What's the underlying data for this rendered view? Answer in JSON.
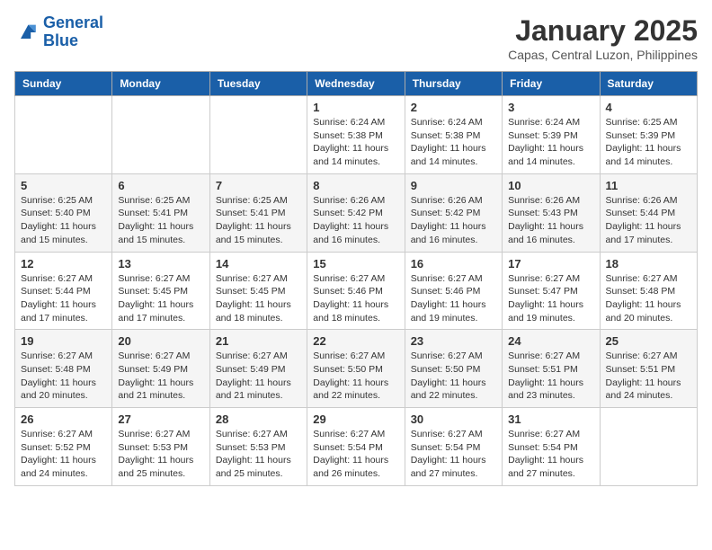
{
  "logo": {
    "line1": "General",
    "line2": "Blue"
  },
  "title": "January 2025",
  "subtitle": "Capas, Central Luzon, Philippines",
  "weekdays": [
    "Sunday",
    "Monday",
    "Tuesday",
    "Wednesday",
    "Thursday",
    "Friday",
    "Saturday"
  ],
  "weeks": [
    [
      {
        "day": "",
        "info": ""
      },
      {
        "day": "",
        "info": ""
      },
      {
        "day": "",
        "info": ""
      },
      {
        "day": "1",
        "info": "Sunrise: 6:24 AM\nSunset: 5:38 PM\nDaylight: 11 hours and 14 minutes."
      },
      {
        "day": "2",
        "info": "Sunrise: 6:24 AM\nSunset: 5:38 PM\nDaylight: 11 hours and 14 minutes."
      },
      {
        "day": "3",
        "info": "Sunrise: 6:24 AM\nSunset: 5:39 PM\nDaylight: 11 hours and 14 minutes."
      },
      {
        "day": "4",
        "info": "Sunrise: 6:25 AM\nSunset: 5:39 PM\nDaylight: 11 hours and 14 minutes."
      }
    ],
    [
      {
        "day": "5",
        "info": "Sunrise: 6:25 AM\nSunset: 5:40 PM\nDaylight: 11 hours and 15 minutes."
      },
      {
        "day": "6",
        "info": "Sunrise: 6:25 AM\nSunset: 5:41 PM\nDaylight: 11 hours and 15 minutes."
      },
      {
        "day": "7",
        "info": "Sunrise: 6:25 AM\nSunset: 5:41 PM\nDaylight: 11 hours and 15 minutes."
      },
      {
        "day": "8",
        "info": "Sunrise: 6:26 AM\nSunset: 5:42 PM\nDaylight: 11 hours and 16 minutes."
      },
      {
        "day": "9",
        "info": "Sunrise: 6:26 AM\nSunset: 5:42 PM\nDaylight: 11 hours and 16 minutes."
      },
      {
        "day": "10",
        "info": "Sunrise: 6:26 AM\nSunset: 5:43 PM\nDaylight: 11 hours and 16 minutes."
      },
      {
        "day": "11",
        "info": "Sunrise: 6:26 AM\nSunset: 5:44 PM\nDaylight: 11 hours and 17 minutes."
      }
    ],
    [
      {
        "day": "12",
        "info": "Sunrise: 6:27 AM\nSunset: 5:44 PM\nDaylight: 11 hours and 17 minutes."
      },
      {
        "day": "13",
        "info": "Sunrise: 6:27 AM\nSunset: 5:45 PM\nDaylight: 11 hours and 17 minutes."
      },
      {
        "day": "14",
        "info": "Sunrise: 6:27 AM\nSunset: 5:45 PM\nDaylight: 11 hours and 18 minutes."
      },
      {
        "day": "15",
        "info": "Sunrise: 6:27 AM\nSunset: 5:46 PM\nDaylight: 11 hours and 18 minutes."
      },
      {
        "day": "16",
        "info": "Sunrise: 6:27 AM\nSunset: 5:46 PM\nDaylight: 11 hours and 19 minutes."
      },
      {
        "day": "17",
        "info": "Sunrise: 6:27 AM\nSunset: 5:47 PM\nDaylight: 11 hours and 19 minutes."
      },
      {
        "day": "18",
        "info": "Sunrise: 6:27 AM\nSunset: 5:48 PM\nDaylight: 11 hours and 20 minutes."
      }
    ],
    [
      {
        "day": "19",
        "info": "Sunrise: 6:27 AM\nSunset: 5:48 PM\nDaylight: 11 hours and 20 minutes."
      },
      {
        "day": "20",
        "info": "Sunrise: 6:27 AM\nSunset: 5:49 PM\nDaylight: 11 hours and 21 minutes."
      },
      {
        "day": "21",
        "info": "Sunrise: 6:27 AM\nSunset: 5:49 PM\nDaylight: 11 hours and 21 minutes."
      },
      {
        "day": "22",
        "info": "Sunrise: 6:27 AM\nSunset: 5:50 PM\nDaylight: 11 hours and 22 minutes."
      },
      {
        "day": "23",
        "info": "Sunrise: 6:27 AM\nSunset: 5:50 PM\nDaylight: 11 hours and 22 minutes."
      },
      {
        "day": "24",
        "info": "Sunrise: 6:27 AM\nSunset: 5:51 PM\nDaylight: 11 hours and 23 minutes."
      },
      {
        "day": "25",
        "info": "Sunrise: 6:27 AM\nSunset: 5:51 PM\nDaylight: 11 hours and 24 minutes."
      }
    ],
    [
      {
        "day": "26",
        "info": "Sunrise: 6:27 AM\nSunset: 5:52 PM\nDaylight: 11 hours and 24 minutes."
      },
      {
        "day": "27",
        "info": "Sunrise: 6:27 AM\nSunset: 5:53 PM\nDaylight: 11 hours and 25 minutes."
      },
      {
        "day": "28",
        "info": "Sunrise: 6:27 AM\nSunset: 5:53 PM\nDaylight: 11 hours and 25 minutes."
      },
      {
        "day": "29",
        "info": "Sunrise: 6:27 AM\nSunset: 5:54 PM\nDaylight: 11 hours and 26 minutes."
      },
      {
        "day": "30",
        "info": "Sunrise: 6:27 AM\nSunset: 5:54 PM\nDaylight: 11 hours and 27 minutes."
      },
      {
        "day": "31",
        "info": "Sunrise: 6:27 AM\nSunset: 5:54 PM\nDaylight: 11 hours and 27 minutes."
      },
      {
        "day": "",
        "info": ""
      }
    ]
  ]
}
